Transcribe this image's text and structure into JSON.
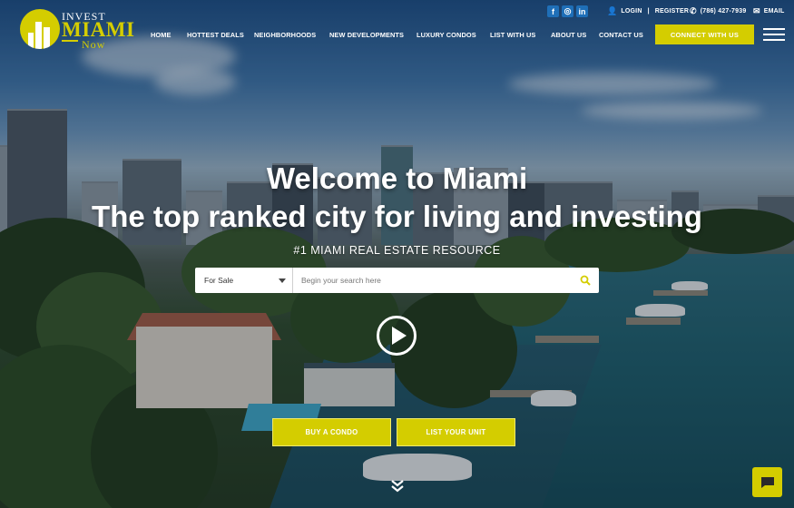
{
  "brand": {
    "word1": "INVEST",
    "word2": "MIAMI",
    "word3": "Now",
    "accent_color": "#d4cd00"
  },
  "social": [
    {
      "icon": "facebook-icon",
      "glyph": "f"
    },
    {
      "icon": "instagram-icon",
      "glyph": "◎"
    },
    {
      "icon": "linkedin-icon",
      "glyph": "in"
    }
  ],
  "utility": {
    "login": "LOGIN",
    "separator": "|",
    "register": "REGISTER",
    "phone": "(786) 427-7939",
    "email": "EMAIL"
  },
  "nav": {
    "items": [
      "HOME",
      "HOTTEST DEALS",
      "NEIGHBORHOODS",
      "NEW DEVELOPMENTS",
      "LUXURY CONDOS",
      "LIST WITH US",
      "ABOUT US",
      "CONTACT US"
    ],
    "connect": "CONNECT WITH US"
  },
  "hero": {
    "headline1": "Welcome to Miami",
    "headline2": "The top ranked city for living and investing",
    "tagline": "#1 MIAMI REAL ESTATE RESOURCE"
  },
  "search": {
    "type_selected": "For Sale",
    "placeholder": "Begin your search here"
  },
  "cta": {
    "buy": "BUY A CONDO",
    "list": "LIST YOUR UNIT"
  }
}
